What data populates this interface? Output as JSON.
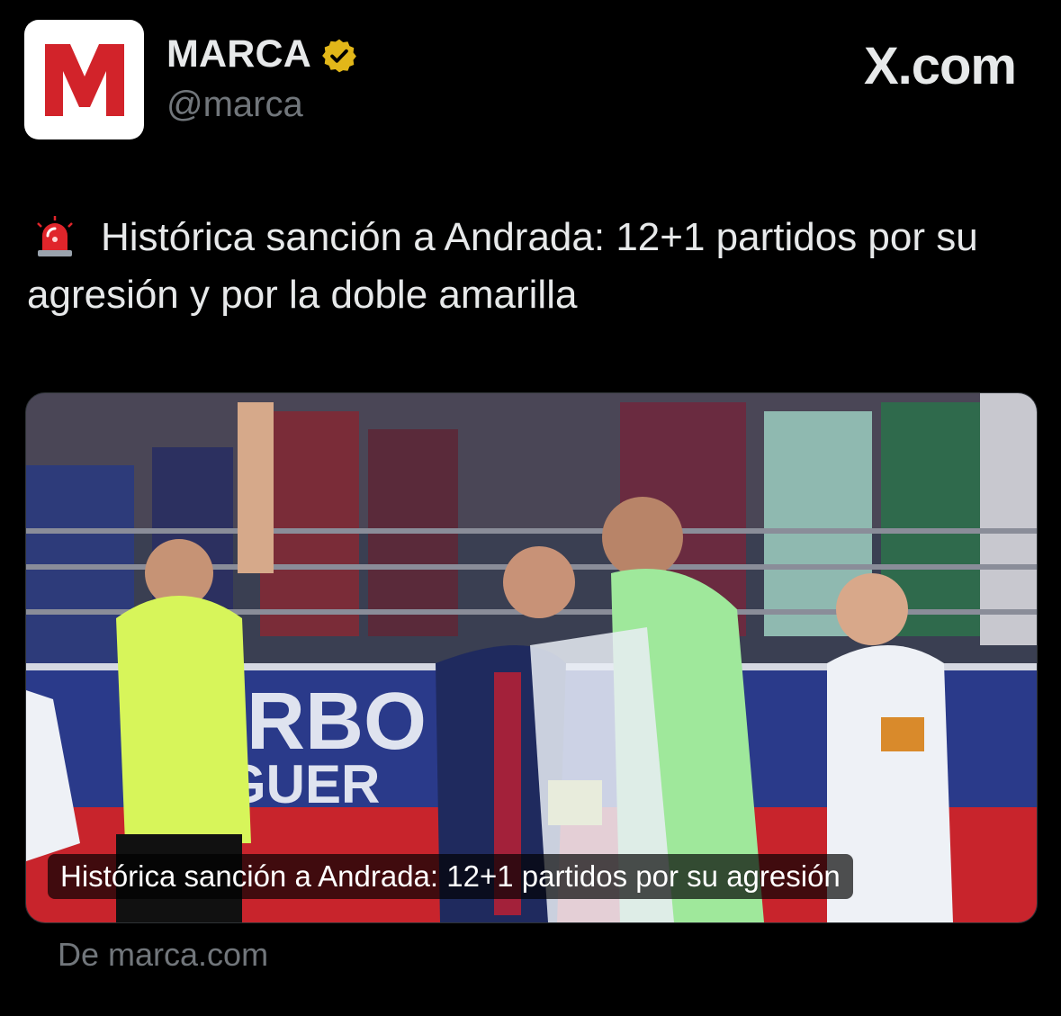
{
  "account": {
    "display_name": "MARCA",
    "handle": "@marca",
    "avatar_letter": "M",
    "avatar_icon": "marca-logo-icon",
    "verified_icon": "verified-badge-icon",
    "verified_color": "#e2b719"
  },
  "brand": {
    "label": "X.com"
  },
  "tweet": {
    "emoji_icon": "rotating-light-icon",
    "text": "Histórica sanción a Andrada: 12+1 partidos por su agresión y por la doble amarilla"
  },
  "card": {
    "caption": "Histórica sanción a Andrada: 12+1 partidos por su agresión",
    "source": "De marca.com"
  },
  "colors": {
    "background": "#000000",
    "text_primary": "#e7e9ea",
    "text_secondary": "#71767b",
    "marca_red": "#d2232a"
  }
}
